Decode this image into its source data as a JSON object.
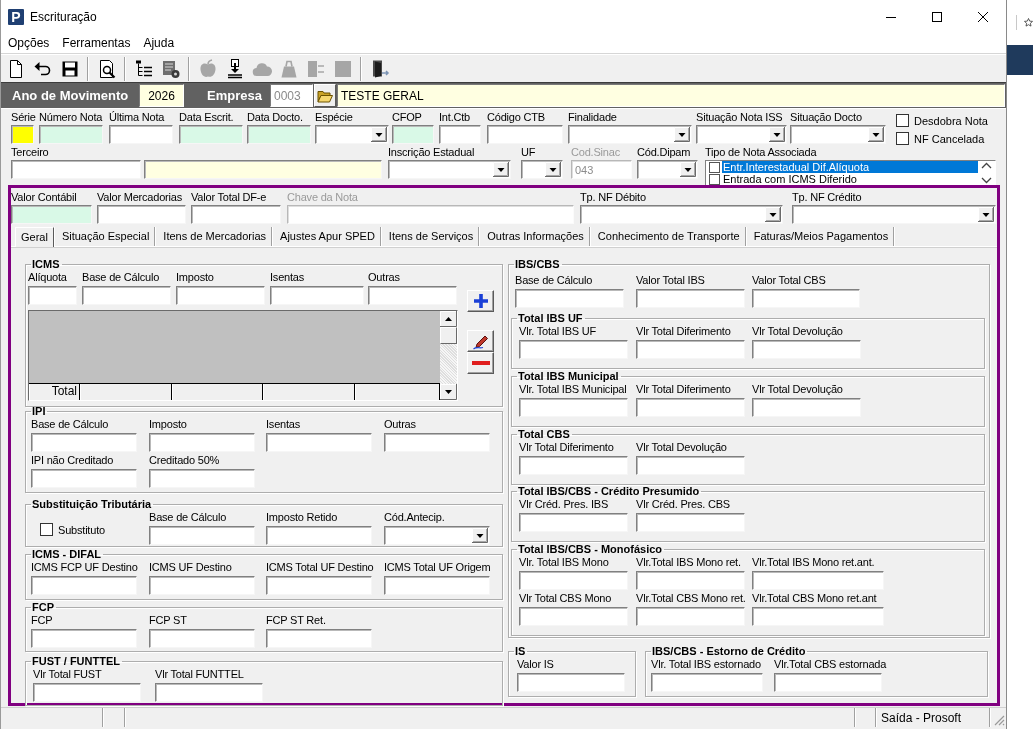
{
  "window": {
    "title": "Escrituração",
    "logo": "P"
  },
  "menu": [
    "Opções",
    "Ferramentas",
    "Ajuda"
  ],
  "toolbar": [
    [
      {
        "kind": "new",
        "disabled": false
      },
      {
        "kind": "undo",
        "disabled": false
      },
      {
        "kind": "save",
        "disabled": false
      }
    ],
    [
      {
        "kind": "preview",
        "disabled": false
      }
    ],
    [
      {
        "kind": "tree",
        "disabled": false
      },
      {
        "kind": "report",
        "disabled": false
      }
    ],
    [
      {
        "kind": "apple",
        "disabled": true
      },
      {
        "kind": "download",
        "disabled": false
      },
      {
        "kind": "cloud",
        "disabled": true
      },
      {
        "kind": "bag",
        "disabled": true
      },
      {
        "kind": "split",
        "disabled": true
      },
      {
        "kind": "square",
        "disabled": true
      }
    ],
    [
      {
        "kind": "exit",
        "disabled": false
      }
    ]
  ],
  "header": {
    "year_label": "Ano de Movimento",
    "year": "2026",
    "company_label": "Empresa",
    "company_code": {
      "value": "0003",
      "disabled": true
    },
    "company_name": "TESTE GERAL"
  },
  "document": {
    "row_1": [
      {
        "label": "Série",
        "kind": "text",
        "color": "#ffff00"
      },
      {
        "label": "Número Nota",
        "kind": "text",
        "color": "#d9f9e7"
      },
      {
        "label": "Última Nota",
        "kind": "text"
      },
      {
        "label": "Data Escrit.",
        "kind": "text",
        "color": "#d9f9e7"
      },
      {
        "label": "Data Docto.",
        "kind": "text",
        "color": "#d9f9e7"
      },
      {
        "label": "Espécie",
        "kind": "combo"
      },
      {
        "label": "CFOP",
        "kind": "text",
        "color": "#d9f9e7"
      },
      {
        "label": "Int.Ctb",
        "kind": "text"
      },
      {
        "label": "Código CTB",
        "kind": "text"
      },
      {
        "label": "Finalidade",
        "kind": "combo"
      },
      {
        "label": "Situação Nota ISS",
        "kind": "combo"
      },
      {
        "label": "Situação Docto",
        "kind": "combo"
      }
    ],
    "flags": [
      {
        "label": "Desdobra Nota",
        "checked": false
      },
      {
        "label": "NF Cancelada",
        "checked": false
      }
    ],
    "row_2": [
      {
        "label": "Terceiro",
        "kind": "text",
        "disabled": false
      },
      {
        "kind": "text",
        "color": "#ffffe1",
        "disabled": false
      },
      {
        "label": "Inscrição Estadual",
        "kind": "combo",
        "disabled": false
      },
      {
        "label": "UF",
        "kind": "combo",
        "disabled": false
      },
      {
        "label": "Cod.Sinac",
        "kind": "text",
        "value": "043",
        "disabled": true
      },
      {
        "label": "Cód.Dipam",
        "kind": "combo",
        "disabled": false
      }
    ],
    "associated_note_type": {
      "label": "Tipo de Nota Associada",
      "items": [
        {
          "label": "Entr.Interestadual Dif.Alíquota",
          "checked": false,
          "selected": true
        },
        {
          "label": "Entrada com ICMS Diferido",
          "checked": false,
          "selected": false
        }
      ]
    }
  },
  "summary_fields": [
    {
      "label": "Valor Contábil",
      "kind": "text",
      "color": "#d9f9e7",
      "disabled": false
    },
    {
      "label": "Valor Mercadorias",
      "kind": "text",
      "disabled": false
    },
    {
      "label": "Valor Total DF-e",
      "kind": "text",
      "disabled": false
    },
    {
      "label": "Chave da Nota",
      "kind": "text",
      "disabled": true
    },
    {
      "label": "Tp. NF Débito",
      "kind": "combo",
      "disabled": false
    },
    {
      "label": "Tp. NF Crédito",
      "kind": "combo",
      "disabled": false
    }
  ],
  "tabs": [
    {
      "label": "Geral",
      "selected": true
    },
    {
      "label": "Situação Especial",
      "selected": false
    },
    {
      "label": "Itens de Mercadorias",
      "selected": false
    },
    {
      "label": "Ajustes Apur SPED",
      "selected": false
    },
    {
      "label": "Itens de Serviços",
      "selected": false
    },
    {
      "label": "Outras Informações",
      "selected": false
    },
    {
      "label": "Conhecimento de Transporte",
      "selected": false
    },
    {
      "label": "Faturas/Meios Pagamentos",
      "selected": false
    }
  ],
  "left_groups": [
    {
      "title": "ICMS",
      "rows": [
        [
          {
            "label": "Alíquota"
          },
          {
            "label": "Base de Cálculo"
          },
          {
            "label": "Imposto"
          },
          {
            "label": "Isentas"
          },
          {
            "label": "Outras"
          }
        ]
      ],
      "grid": {
        "total_label": "Total"
      }
    },
    {
      "title": "IPI",
      "rows": [
        [
          {
            "label": "Base de Cálculo"
          },
          {
            "label": "Imposto"
          },
          {
            "label": "Isentas"
          },
          {
            "label": "Outras"
          }
        ],
        [
          {
            "label": "IPI não Creditado"
          },
          {
            "label": "Creditado 50%"
          }
        ]
      ]
    },
    {
      "title": "Substituição Tributária",
      "rows": [
        [
          {
            "label": "Substituto",
            "kind": "checkbox",
            "checked": false
          },
          {
            "label": "Base de Cálculo",
            "kind": "text"
          },
          {
            "label": "Imposto Retido",
            "kind": "text"
          },
          {
            "label": "Cód.Antecip.",
            "kind": "combo"
          }
        ]
      ]
    },
    {
      "title": "ICMS - DIFAL",
      "rows": [
        [
          {
            "label": "ICMS FCP UF Destino"
          },
          {
            "label": "ICMS UF Destino"
          },
          {
            "label": "ICMS Total UF Destino"
          },
          {
            "label": "ICMS Total UF Origem"
          }
        ]
      ]
    },
    {
      "title": "FCP",
      "rows": [
        [
          {
            "label": "FCP"
          },
          {
            "label": "FCP ST"
          },
          {
            "label": "FCP ST Ret."
          }
        ]
      ]
    },
    {
      "title": "FUST / FUNTTEL",
      "rows": [
        [
          {
            "label": "Vlr Total FUST"
          },
          {
            "label": "Vlr Total FUNTTEL"
          }
        ]
      ]
    }
  ],
  "ibs_cbs": {
    "title": "IBS/CBS",
    "rows": [
      [
        {
          "label": "Base de Cálculo"
        },
        {
          "label": "Valor Total IBS"
        },
        {
          "label": "Valor Total CBS"
        }
      ]
    ],
    "groups": [
      {
        "title": "Total IBS UF",
        "rows": [
          [
            {
              "label": "Vlr. Total IBS UF"
            },
            {
              "label": "Vlr Total Diferimento"
            },
            {
              "label": "Vlr Total Devolução"
            }
          ]
        ]
      },
      {
        "title": "Total IBS Municipal",
        "rows": [
          [
            {
              "label": "Vlr. Total IBS Municipal"
            },
            {
              "label": "Vlr Total Diferimento"
            },
            {
              "label": "Vlr Total Devolução"
            }
          ]
        ]
      },
      {
        "title": "Total CBS",
        "rows": [
          [
            {
              "label": "Vlr Total Diferimento"
            },
            {
              "label": "Vlr Total Devolução"
            }
          ]
        ]
      },
      {
        "title": "Total IBS/CBS - Crédito Presumido",
        "rows": [
          [
            {
              "label": "Vlr Créd. Pres. IBS"
            },
            {
              "label": "Vlr Créd. Pres. CBS"
            }
          ]
        ]
      },
      {
        "title": "Total IBS/CBS - Monofásico",
        "rows": [
          [
            {
              "label": "Vlr. Total IBS Mono"
            },
            {
              "label": "Vlr.Total IBS Mono ret."
            },
            {
              "label": "Vlr.Total IBS Mono ret.ant."
            }
          ],
          [
            {
              "label": "Vlr Total CBS Mono"
            },
            {
              "label": "Vlr.Total CBS Mono ret."
            },
            {
              "label": "Vlr.Total CBS Mono ret.ant"
            }
          ]
        ]
      }
    ]
  },
  "bottom_groups": [
    {
      "title": "IS",
      "rows": [
        [
          {
            "label": "Valor IS"
          }
        ]
      ]
    },
    {
      "title": "IBS/CBS - Estorno de Crédito",
      "rows": [
        [
          {
            "label": "Vlr. Total IBS estornado"
          },
          {
            "label": "Vlr.Total CBS estornada"
          }
        ]
      ]
    }
  ],
  "status_bar": {
    "text": "Saída - Prosoft"
  }
}
